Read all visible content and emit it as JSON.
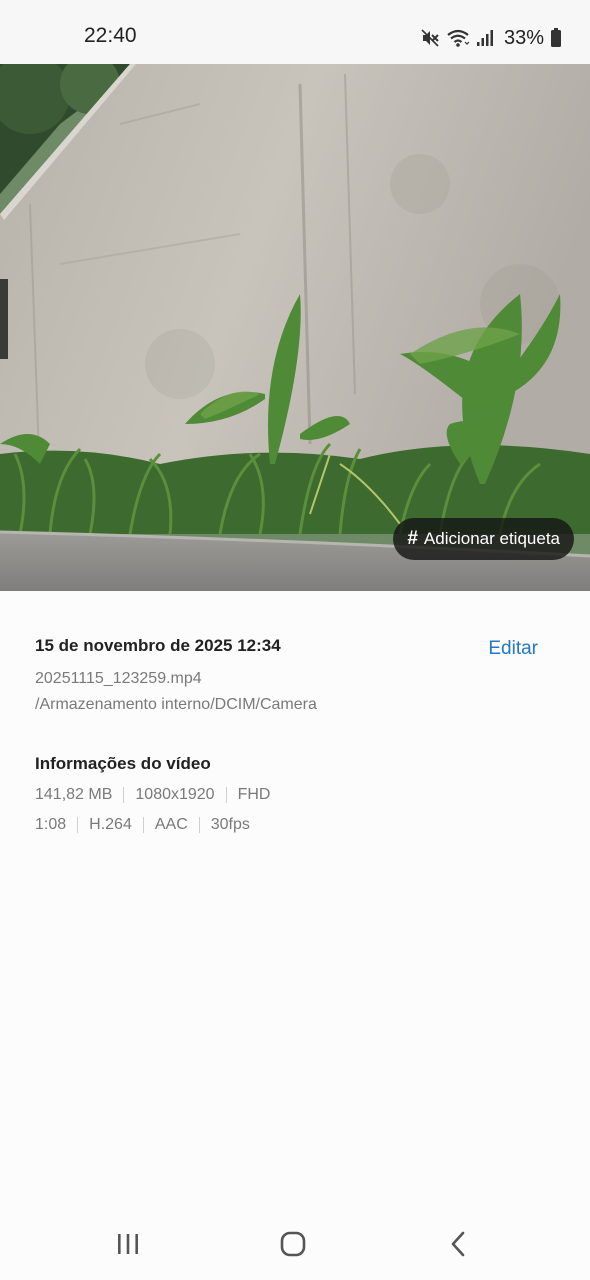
{
  "status_bar": {
    "time": "22:40",
    "battery": "33%",
    "icons": [
      "mute-icon",
      "wifi-icon",
      "signal-icon",
      "battery-icon"
    ]
  },
  "photo": {
    "tag_button_label": "Adicionar etiqueta",
    "tag_button_prefix": "#"
  },
  "details": {
    "date": "15 de novembro de 2025 12:34",
    "edit_label": "Editar",
    "file_name": "20251115_123259.mp4",
    "file_path": "/Armazenamento interno/DCIM/Camera"
  },
  "video_info": {
    "title": "Informações do vídeo",
    "row1": [
      "141,82 MB",
      "1080x1920",
      "FHD"
    ],
    "row2": [
      "1:08",
      "H.264",
      "AAC",
      "30fps"
    ]
  },
  "nav_bar": {
    "icons": [
      "recent-apps-icon",
      "home-icon",
      "back-icon"
    ]
  },
  "colors": {
    "accent": "#2478c8",
    "secondary_text": "#7a7a7a"
  }
}
